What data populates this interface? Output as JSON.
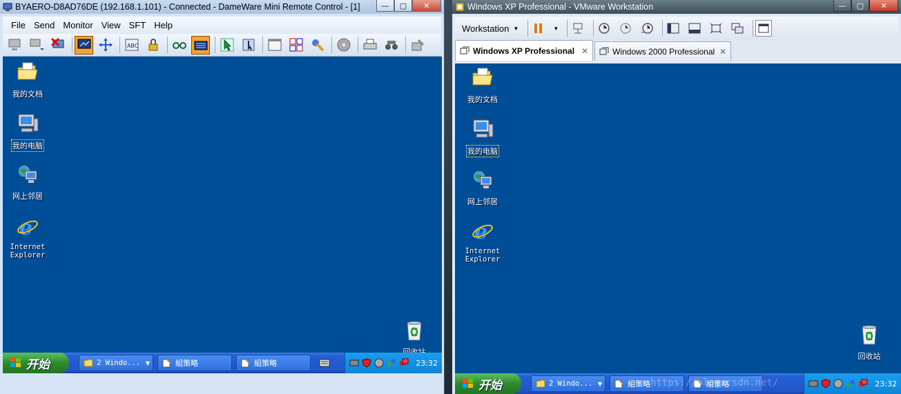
{
  "left_window": {
    "title": "BYAERO-D8AD76DE (192.168.1.101) - Connected - DameWare Mini Remote Control - [1]",
    "menu": [
      "File",
      "Send",
      "Monitor",
      "View",
      "SFT",
      "Help"
    ],
    "desktop_icons": [
      "我的文档",
      "我的电脑",
      "网上邻居",
      "Internet Explorer",
      "回收站"
    ],
    "taskbar": {
      "start": "开始",
      "buttons": [
        "2 Windo...",
        "組策略",
        "組策略"
      ],
      "clock": "23:32"
    }
  },
  "right_window": {
    "title": "Windows XP Professional - VMware Workstation",
    "toolbar_menu": "Workstation",
    "tabs": [
      "Windows XP Professional",
      "Windows 2000 Professional"
    ],
    "desktop_icons": [
      "我的文档",
      "我的电脑",
      "网上邻居",
      "Internet Explorer",
      "回收站"
    ],
    "taskbar": {
      "start": "开始",
      "buttons": [
        "2 Windo...",
        "組策略",
        "組策略"
      ],
      "clock": "23:32"
    }
  },
  "watermark": "https://blog.csdn.net/"
}
